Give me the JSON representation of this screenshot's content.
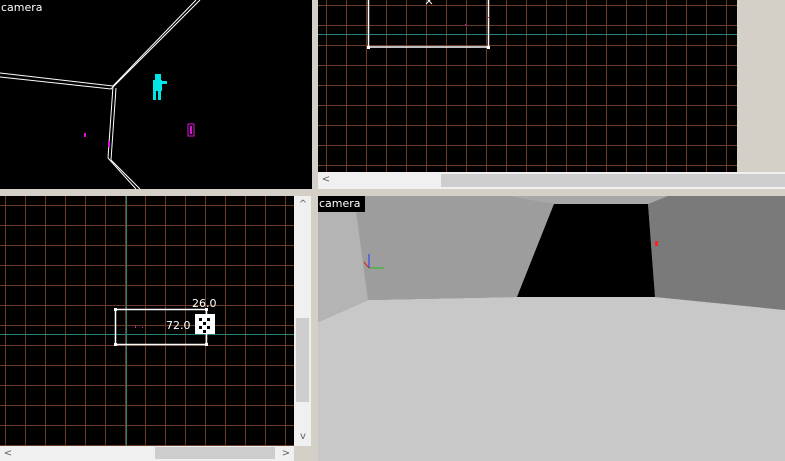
{
  "viewports": {
    "top_left": {
      "label": "camera"
    },
    "top_right": {
      "scrollbar_left_arrow": "<"
    },
    "bottom_left": {
      "label_width": "72.0",
      "label_height": "26.0",
      "scrollbar_up_arrow": "^",
      "scrollbar_down_arrow": "v",
      "scrollbar_left_arrow": "<",
      "scrollbar_right_arrow": ">"
    },
    "bottom_right": {
      "label": "camera"
    }
  },
  "colors": {
    "viewport_background": "#000000",
    "grid_line": "#6a3b22",
    "axis_line": "#2c7f7a",
    "brush_outline": "#ffffff",
    "entity_player": "#00e5e5",
    "entity_item": "#e010e0",
    "entity_marker": "#ff2020",
    "frame": "#d4d0c8"
  },
  "icons": {
    "player_entity": "player-entity-icon",
    "gizmo": "axis-gizmo-icon",
    "resize_handle": "resize-handle-icon"
  }
}
